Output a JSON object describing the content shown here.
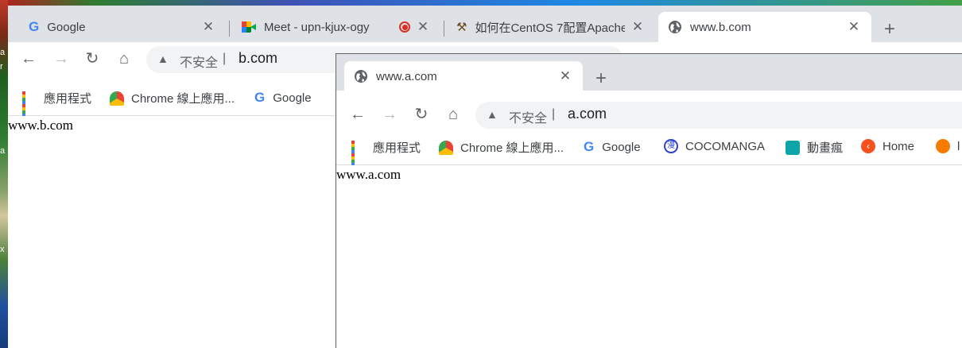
{
  "back_window": {
    "tabs": [
      {
        "title": "Google",
        "icon": "google-icon"
      },
      {
        "title": "Meet - upn-kjux-ogy",
        "icon": "meet-icon",
        "recording": true
      },
      {
        "title": "如何在CentOS 7配置Apache",
        "icon": "site-icon"
      },
      {
        "title": "www.b.com",
        "icon": "globe-icon",
        "active": true
      }
    ],
    "omnibox": {
      "security": "不安全",
      "separator": "|",
      "url": "b.com"
    },
    "bookmarks": [
      {
        "label": "應用程式",
        "icon": "apps-icon"
      },
      {
        "label": "Chrome 線上應用...",
        "icon": "chrome-webstore-icon"
      },
      {
        "label": "Google",
        "icon": "google-icon"
      }
    ],
    "page_text": "www.b.com"
  },
  "front_window": {
    "tabs": [
      {
        "title": "www.a.com",
        "icon": "globe-icon",
        "active": true
      }
    ],
    "omnibox": {
      "security": "不安全",
      "separator": "|",
      "url": "a.com"
    },
    "bookmarks": [
      {
        "label": "應用程式",
        "icon": "apps-icon"
      },
      {
        "label": "Chrome 線上應用...",
        "icon": "chrome-webstore-icon"
      },
      {
        "label": "Google",
        "icon": "google-icon"
      },
      {
        "label": "COCOMANGA",
        "icon": "cocomanga-icon"
      },
      {
        "label": "動畫瘋",
        "icon": "anime-icon"
      },
      {
        "label": "Home",
        "icon": "home-site-icon"
      },
      {
        "label": "l",
        "icon": "bird-icon"
      }
    ],
    "page_text": "www.a.com"
  },
  "desktop": {
    "edge_letters": [
      "a",
      "r",
      "a",
      "x"
    ]
  },
  "colors": {
    "tabstrip": "#dee1e6",
    "omnibox": "#f1f3f4",
    "accent_google_blue": "#4285f4",
    "record_red": "#d93025"
  }
}
